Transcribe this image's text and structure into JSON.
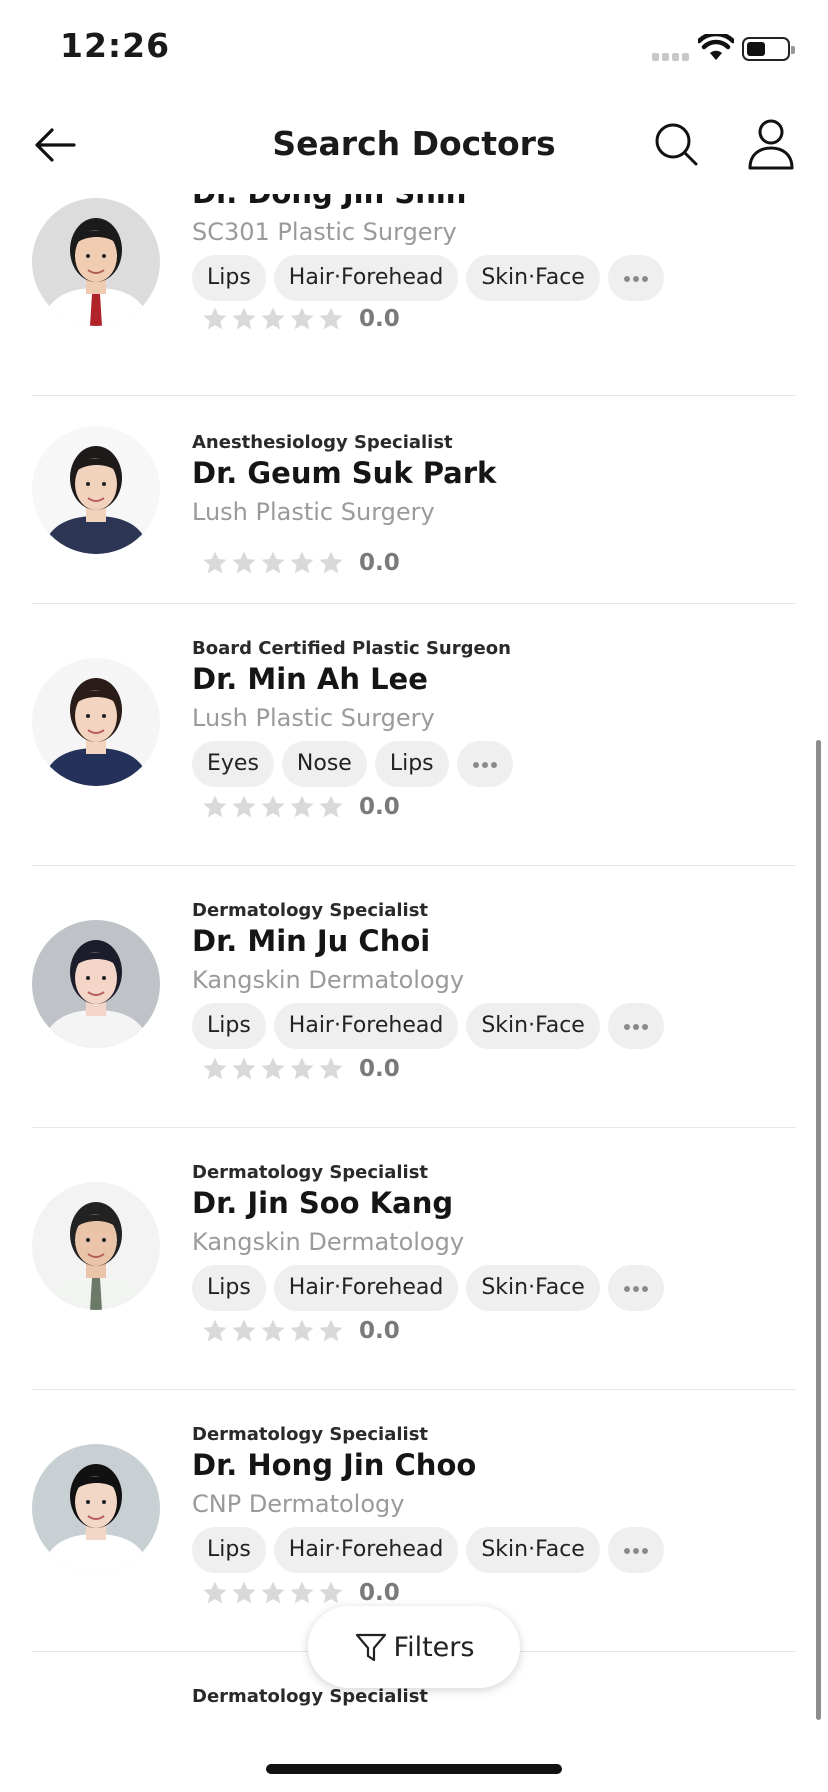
{
  "status_bar": {
    "time": "12:26"
  },
  "header": {
    "title": "Search Doctors"
  },
  "doctors": [
    {
      "specialty": "",
      "name": "Dr. Dong Jin Shin",
      "clinic": "SC301 Plastic Surgery",
      "tags": [
        "Lips",
        "Hair·Forehead",
        "Skin·Face"
      ],
      "rating": "0.0"
    },
    {
      "specialty": "Anesthesiology Specialist",
      "name": "Dr. Geum Suk Park",
      "clinic": "Lush Plastic Surgery",
      "tags": [],
      "rating": "0.0"
    },
    {
      "specialty": "Board Certified Plastic Surgeon",
      "name": "Dr. Min Ah Lee",
      "clinic": "Lush Plastic Surgery",
      "tags": [
        "Eyes",
        "Nose",
        "Lips"
      ],
      "rating": "0.0"
    },
    {
      "specialty": "Dermatology Specialist",
      "name": "Dr. Min Ju Choi",
      "clinic": "Kangskin Dermatology",
      "tags": [
        "Lips",
        "Hair·Forehead",
        "Skin·Face"
      ],
      "rating": "0.0"
    },
    {
      "specialty": "Dermatology Specialist",
      "name": "Dr. Jin Soo Kang",
      "clinic": "Kangskin Dermatology",
      "tags": [
        "Lips",
        "Hair·Forehead",
        "Skin·Face"
      ],
      "rating": "0.0"
    },
    {
      "specialty": "Dermatology Specialist",
      "name": "Dr. Hong Jin Choo",
      "clinic": "CNP Dermatology",
      "tags": [
        "Lips",
        "Hair·Forehead",
        "Skin·Face"
      ],
      "rating": "0.0"
    },
    {
      "specialty": "Dermatology Specialist",
      "name": "",
      "clinic": "",
      "tags": [],
      "rating": ""
    }
  ],
  "filters": {
    "label": "Filters"
  },
  "icons": {
    "back": "arrow-left-icon",
    "search": "search-icon",
    "profile": "user-icon",
    "filter": "filter-icon",
    "more": "more-dots-icon",
    "star": "star-icon"
  },
  "colors": {
    "tag_bg": "#efefef",
    "star_empty": "#d9d9d9",
    "clinic_text": "#9a9a9a"
  }
}
